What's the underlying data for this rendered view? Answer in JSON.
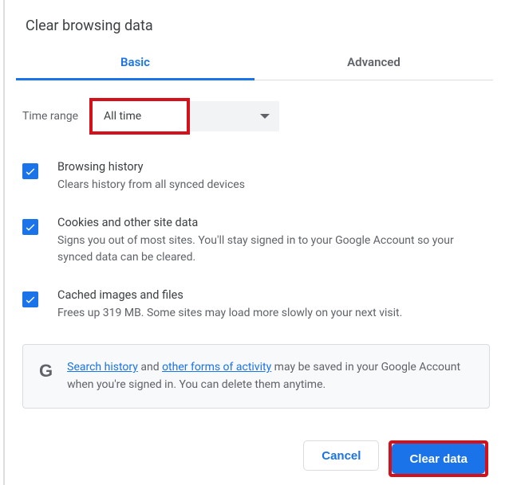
{
  "title": "Clear browsing data",
  "tabs": {
    "basic": "Basic",
    "advanced": "Advanced"
  },
  "timerange": {
    "label": "Time range",
    "value": "All time"
  },
  "options": {
    "history": {
      "title": "Browsing history",
      "desc": "Clears history from all synced devices"
    },
    "cookies": {
      "title": "Cookies and other site data",
      "desc": "Signs you out of most sites. You'll stay signed in to your Google Account so your synced data can be cleared."
    },
    "cache": {
      "title": "Cached images and files",
      "desc": "Frees up 319 MB. Some sites may load more slowly on your next visit."
    }
  },
  "info": {
    "link1": "Search history",
    "mid1": " and ",
    "link2": "other forms of activity",
    "rest": " may be saved in your Google Account when you're signed in. You can delete them anytime."
  },
  "buttons": {
    "cancel": "Cancel",
    "clear": "Clear data"
  }
}
